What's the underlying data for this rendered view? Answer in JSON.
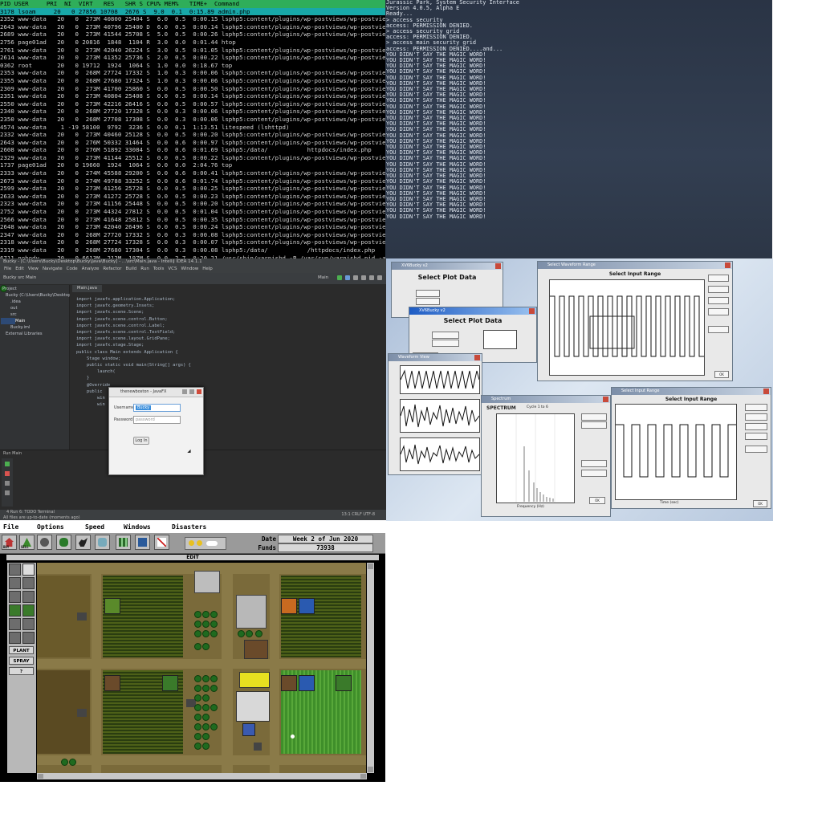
{
  "htop": {
    "header": "PID USER     PRI  NI  VIRT   RES   SHR S CPU% MEM%   TIME+  Command",
    "selected_row": "3178 lsoam     20   0 27856 10708  2676 S  9.0  0.1  0:15.89 admin.php",
    "rows": [
      "2352 www-data   20   0  273M 40800 25404 S  6.0  0.5  0:00.15 lsphp5:content/plugins/wp-postviews/wp-postviews.php",
      "2643 www-data   20   0  273M 40796 25400 D  6.0  0.5  0:00.14 lsphp5:content/plugins/wp-postviews/wp-postviews.php",
      "2689 www-data   20   0  273M 41544 25708 S  5.0  0.5  0:00.26 lsphp5:content/plugins/wp-postviews/wp-postviews.php",
      "2756 page01ad   20   0 20816  1848  1104 R  3.0  0.0  0:01.44 htop",
      "2761 www-data   20   0  273M 42040 26224 S  3.0  0.5  0:01.05 lsphp5:content/plugins/wp-postviews/wp-postviews.php",
      "2614 www-data   20   0  273M 41352 25736 S  2.0  0.5  0:00.22 lsphp5:content/plugins/wp-postviews/wp-postviews.php",
      "0362 root       20   0 19712  1924  1064 S  1.0  0.0  0:18.67 top",
      "2353 www-data   20   0  268M 27724 17332 S  1.0  0.3  0:00.06 lsphp5:content/plugins/wp-postviews/wp-postviews.php",
      "2355 www-data   20   0  268M 27680 17324 S  1.0  0.3  0:00.06 lsphp5:content/plugins/wp-postviews/wp-postviews.php",
      "2309 www-data   20   0  273M 41700 25860 S  0.0  0.5  0:00.50 lsphp5:content/plugins/wp-postviews/wp-postviews.php",
      "2351 www-data   20   0  273M 40804 25408 S  0.0  0.5  0:00.14 lsphp5:content/plugins/wp-postviews/wp-postviews.php",
      "2550 www-data   20   0  273M 42216 26416 S  0.0  0.5  0:00.57 lsphp5:content/plugins/wp-postviews/wp-postviews.php",
      "2340 www-data   20   0  268M 27720 17328 S  0.0  0.3  0:00.06 lsphp5:content/plugins/wp-postviews/wp-postviews.php",
      "2350 www-data   20   0  268M 27708 17308 S  0.0  0.3  0:00.06 lsphp5:content/plugins/wp-postviews/wp-postviews.php",
      "4574 www-data    1 -19 58100  9792  3236 S  0.0  0.1  1:13.51 litespeed (lshttpd)",
      "2332 www-data   20   0  273M 40460 25128 S  0.0  0.5  0:00.20 lsphp5:content/plugins/wp-postviews/wp-postviews.php",
      "2643 www-data   20   0  276M 50332 31464 S  0.0  0.6  0:00.97 lsphp5:content/plugins/wp-postviews/wp-postviews.php",
      "2608 www-data   20   0  276M 51892 33084 S  0.0  0.6  0:01.69 lsphp5:/data/           httpdocs/index.php",
      "2329 www-data   20   0  273M 41144 25512 S  0.0  0.5  0:00.22 lsphp5:content/plugins/wp-postviews/wp-postviews.php",
      "1737 page01ad   20   0 19660  1924  1064 S  0.0  0.0  2:04.76 top",
      "2333 www-data   20   0  274M 45588 29200 S  0.0  0.6  0:00.41 lsphp5:content/plugins/wp-postviews/wp-postviews.php",
      "2673 www-data   20   0  274M 49788 33252 S  0.0  0.6  0:01.74 lsphp5:content/plugins/wp-postviews/wp-postviews.php",
      "2599 www-data   20   0  273M 41256 25728 S  0.0  0.5  0:00.25 lsphp5:content/plugins/wp-postviews/wp-postviews.php",
      "2633 www-data   20   0  273M 41272 25728 S  0.0  0.5  0:00.23 lsphp5:content/plugins/wp-postviews/wp-postviews.php",
      "2323 www-data   20   0  273M 41156 25448 S  0.0  0.5  0:00.20 lsphp5:content/plugins/wp-postviews/wp-postviews.php",
      "2752 www-data   20   0  273M 44324 27812 S  0.0  0.5  0:01.04 lsphp5:content/plugins/wp-postviews/wp-postviews.php",
      "2566 www-data   20   0  273M 41648 25812 S  0.0  0.5  0:00.35 lsphp5:content/plugins/wp-postviews/wp-postviews.php",
      "2648 www-data   20   0  273M 42040 26496 S  0.0  0.5  0:00.24 lsphp5:content/plugins/wp-postviews/wp-postviews.php",
      "2347 www-data   20   0  268M 27720 17332 S  0.0  0.3  0:00.08 lsphp5:content/plugins/wp-postviews/wp-postviews.php",
      "2318 www-data   20   0  268M 27724 17328 S  0.0  0.3  0:00.07 lsphp5:content/plugins/wp-postviews/wp-postviews.php",
      "2319 www-data   20   0  268M 27680 17304 S  0.0  0.3  0:00.08 lsphp5:/data/           /httpdocs/index.php",
      "6711 nobody     20   0 6613M  212M  197M S  0.0  2.7  0:20.21 /usr/sbin/varnishd -P /var/run/varnishd.pid -a :80 -T local"
    ]
  },
  "jurassic": {
    "lines": [
      "Jurassic Park, System Security Interface",
      "Version 4.0.5, Alpha E",
      "Ready...",
      "> access security",
      "access: PERMISSION DENIED.",
      "> access security grid",
      "access: PERMISSION DENIED.",
      "> access main security grid",
      "access: PERMISSION DENIED....and..."
    ],
    "repeat_line": "YOU DIDN'T SAY THE MAGIC WORD!",
    "repeat_count": 29
  },
  "ide": {
    "title": "Bucky - [C:\\Users\\Bucky\\Desktop\\Bucky\\Java\\Bucky] - ...\\src\\Main.java - IntelliJ IDEA 14.1.1",
    "menu": [
      "File",
      "Edit",
      "View",
      "Navigate",
      "Code",
      "Analyze",
      "Refactor",
      "Build",
      "Run",
      "Tools",
      "VCS",
      "Window",
      "Help"
    ],
    "breadcrumb": "Bucky  src  Main",
    "run_config": "Main",
    "tree": [
      "Project",
      "Bucky (C:\\Users\\Bucky\\Desktop\\Bucky)",
      ".idea",
      "out",
      "src",
      "Main",
      "Bucky.iml",
      "External Libraries"
    ],
    "tab": "Main.java",
    "code": [
      "import javafx.application.Application;",
      "import javafx.geometry.Insets;",
      "import javafx.scene.Scene;",
      "import javafx.scene.control.Button;",
      "import javafx.scene.control.Label;",
      "import javafx.scene.control.TextField;",
      "import javafx.scene.layout.GridPane;",
      "import javafx.stage.Stage;",
      "",
      "public class Main extends Application {",
      "",
      "    Stage window;",
      "",
      "    public static void main(String[] args) {",
      "        launch(",
      "    }",
      "",
      "    @Override",
      "    public",
      "        win",
      "        win"
    ],
    "run_header": "Run  Main",
    "status_line1": "4 Run    6: TODO    Terminal",
    "status_line2": "All files are up-to-date (moments ago)",
    "status_right": "13:1   CRLF   UTF-8",
    "dialog": {
      "title": "thenewboston - JavaFX",
      "username_label": "Username:",
      "username_value": "Bucky",
      "password_label": "Password:",
      "password_placeholder": "password",
      "login_button": "Log In"
    }
  },
  "plots": {
    "w1_title": "XV6Bucky v2",
    "w1_heading": "Select Plot Data",
    "w2_title": "XV6Bucky v2",
    "w2_heading": "Select Plot Data",
    "w3_title": "Select Waveform Range",
    "w3_heading": "Select Input Range",
    "w4_title": "Waveform View",
    "w5_title": "Spectrum",
    "w5_heading": "SPECTRUM",
    "w5_sub": "Cycle 1 to 6",
    "w5_xlabel": "Frequency (Hz)",
    "w6_title": "Select Input Range",
    "w6_heading": "Select Input Range",
    "w6_xlabel": "Time (sec)",
    "ok": "OK"
  },
  "simfarm": {
    "menu": [
      "File",
      "Options",
      "Speed",
      "Windows",
      "Disasters"
    ],
    "date_label": "Date",
    "date_value": "Week 2 of Jun 2020",
    "funds_label": "Funds",
    "funds_value": "73938",
    "mode": "EDIT",
    "tool_buttons": [
      "BUY",
      "SELL",
      "",
      "",
      "",
      "",
      "",
      "",
      ""
    ],
    "plant_label": "PLANT",
    "spray_label": "SPRAY",
    "help_label": "?"
  },
  "colors": {
    "htop_header": "#2fae5a",
    "htop_selected": "#18a8a8",
    "jp_bg": "#2a3445",
    "ide_bg": "#2b2d30",
    "sim_ui": "#c8c8c8"
  }
}
